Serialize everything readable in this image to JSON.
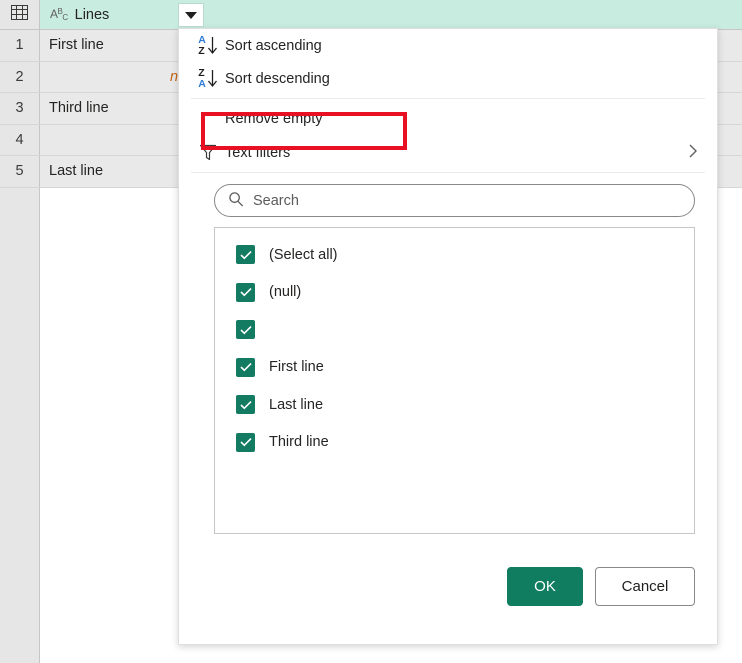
{
  "grid": {
    "column": {
      "type_icon": "abc-text-type-icon",
      "title": "Lines",
      "dropdown_icon": "caret-down-icon",
      "table_icon": "table-grid-icon"
    },
    "rows": [
      {
        "num": "1",
        "value": "First line",
        "is_null": false
      },
      {
        "num": "2",
        "value": "null",
        "is_null": true
      },
      {
        "num": "3",
        "value": "Third line",
        "is_null": false
      },
      {
        "num": "4",
        "value": "",
        "is_null": false
      },
      {
        "num": "5",
        "value": "Last line",
        "is_null": false
      }
    ]
  },
  "filter_panel": {
    "menu": [
      {
        "label": "Sort ascending",
        "icon": "sort-ascending-icon",
        "top": "A",
        "bottom": "Z"
      },
      {
        "label": "Sort descending",
        "icon": "sort-descending-icon",
        "top": "Z",
        "bottom": "A"
      },
      {
        "label": "Remove empty",
        "icon": "none",
        "highlighted": true
      },
      {
        "label": "Text filters",
        "icon": "funnel-icon",
        "submenu_icon": "chevron-right-icon"
      }
    ],
    "search": {
      "icon": "search-icon",
      "placeholder": "Search",
      "value": ""
    },
    "values": [
      {
        "label": "(Select all)",
        "checked": true
      },
      {
        "label": "(null)",
        "checked": true
      },
      {
        "label": "",
        "checked": true
      },
      {
        "label": "First line",
        "checked": true
      },
      {
        "label": "Last line",
        "checked": true
      },
      {
        "label": "Third line",
        "checked": true
      }
    ],
    "buttons": {
      "ok": "OK",
      "cancel": "Cancel"
    }
  },
  "colors": {
    "header_bg": "#c9ece0",
    "checkbox_green": "#147b63",
    "ok_button_green": "#107c60",
    "highlight_red": "#e81123",
    "null_orange": "#c46516",
    "sort_letter_blue": "#2e7cd6"
  }
}
